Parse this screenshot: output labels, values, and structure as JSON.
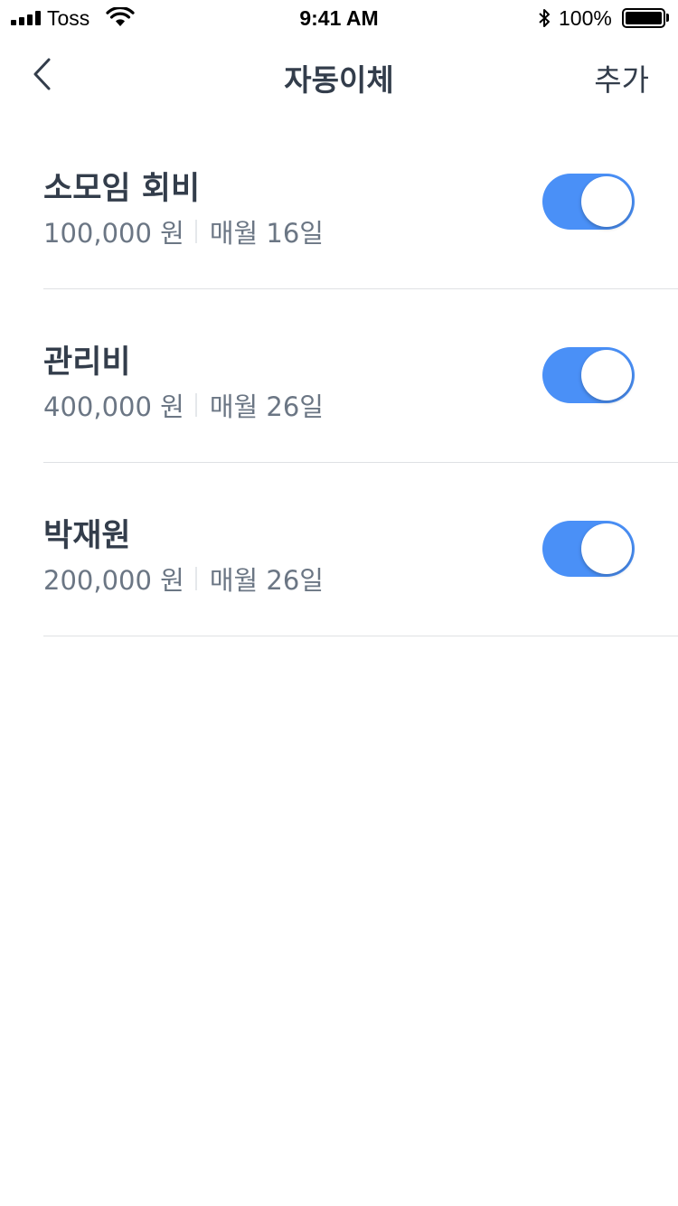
{
  "status_bar": {
    "carrier": "Toss",
    "time": "9:41 AM",
    "battery_percent": "100%",
    "battery_level": 1.0
  },
  "nav": {
    "title": "자동이체",
    "add_label": "추가"
  },
  "transfers": [
    {
      "name": "소모임 회비",
      "amount": "100,000 원",
      "schedule": "매월 16일",
      "enabled": true
    },
    {
      "name": "관리비",
      "amount": "400,000 원",
      "schedule": "매월 26일",
      "enabled": true
    },
    {
      "name": "박재원",
      "amount": "200,000 원",
      "schedule": "매월 26일",
      "enabled": true
    }
  ],
  "colors": {
    "toggle_on": "#4a90f7",
    "text_primary": "#333d4b",
    "text_secondary": "#6b7684",
    "divider": "#dfe1e4"
  }
}
